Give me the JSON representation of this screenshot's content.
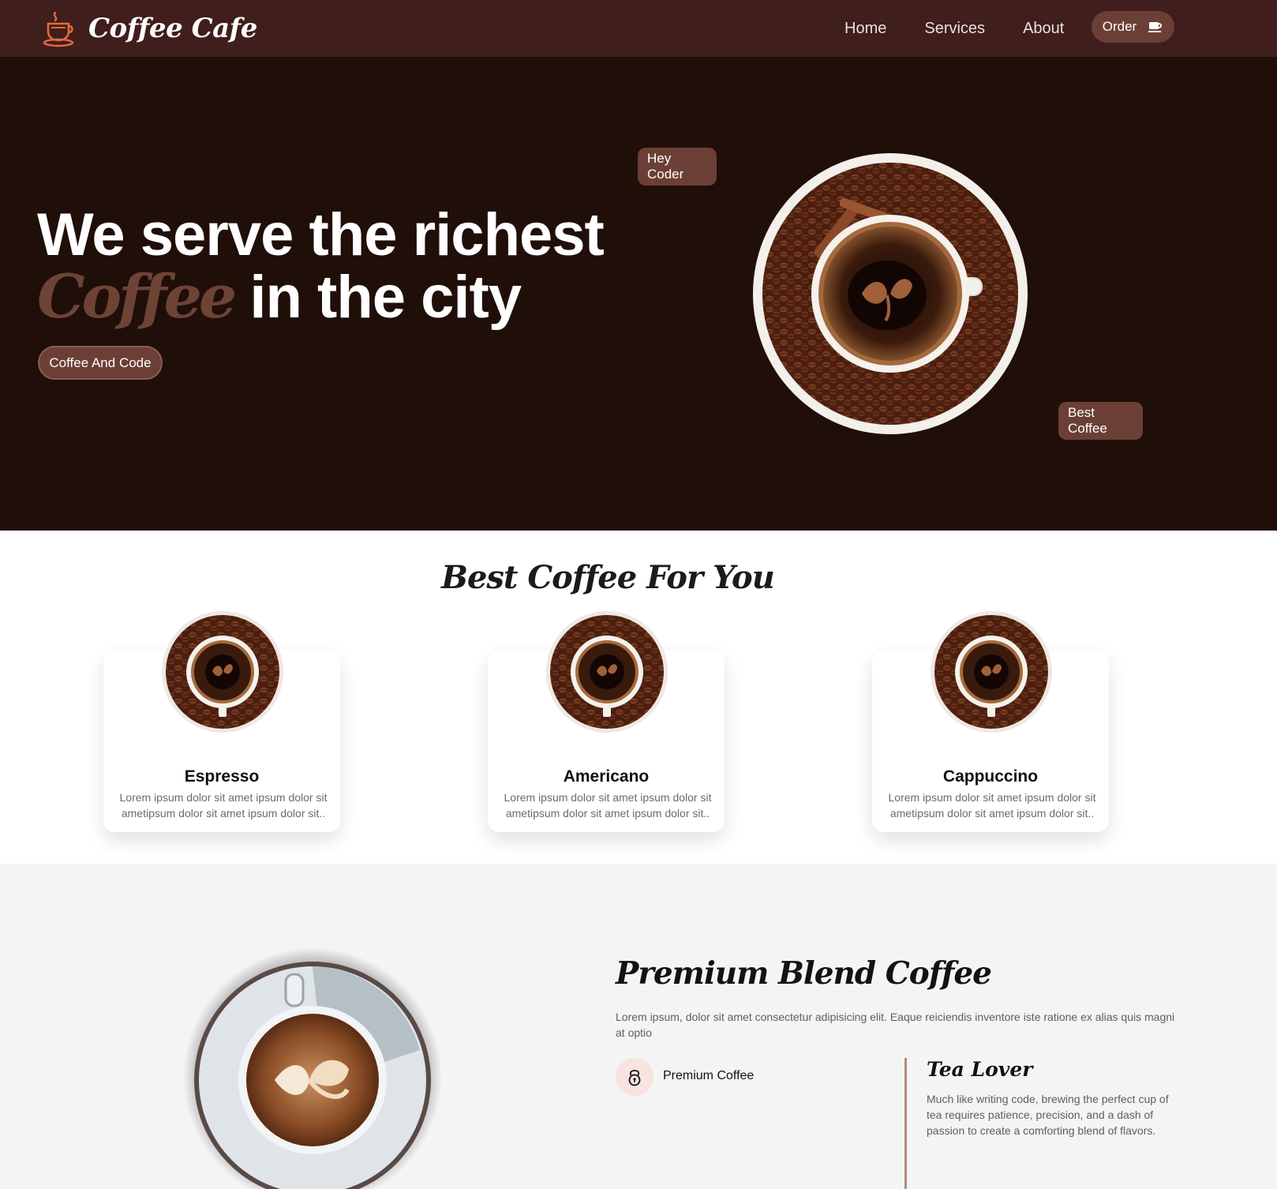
{
  "nav": {
    "brand": "Coffee Cafe",
    "links": [
      "Home",
      "Services",
      "About"
    ],
    "order_label": "Order"
  },
  "hero": {
    "title_line1": "We serve the richest",
    "title_accent": "Coffee",
    "title_rest": " in the city",
    "cta_label": "Coffee And Code",
    "tag_top": "Hey Coder",
    "tag_bottom": "Best Coffee"
  },
  "best": {
    "title": "Best Coffee For You",
    "cards": [
      {
        "name": "Espresso",
        "desc": "Lorem ipsum dolor sit amet ipsum dolor sit ametipsum dolor sit amet ipsum dolor sit.."
      },
      {
        "name": "Americano",
        "desc": "Lorem ipsum dolor sit amet ipsum dolor sit ametipsum dolor sit amet ipsum dolor sit.."
      },
      {
        "name": "Cappuccino",
        "desc": "Lorem ipsum dolor sit amet ipsum dolor sit ametipsum dolor sit amet ipsum dolor sit.."
      }
    ]
  },
  "premium": {
    "title": "Premium Blend Coffee",
    "desc": "Lorem ipsum, dolor sit amet consectetur adipisicing elit. Eaque reiciendis inventore iste ratione ex alias quis magni at optio",
    "feature_label": "Premium Coffee",
    "tea_title": "Tea Lover",
    "tea_desc": "Much like writing code, brewing the perfect cup of tea requires patience, precision, and a dash of passion to create a comforting blend of flavors."
  },
  "colors": {
    "nav_bg": "#3f1e1c",
    "hero_bg": "#200e09",
    "accent_brown": "#6b3f36",
    "premium_bg": "#f4f4f4"
  },
  "icons": {
    "logo": "coffee-cup-steam-icon",
    "order": "coffee-cup-icon",
    "feature": "lock-icon"
  }
}
